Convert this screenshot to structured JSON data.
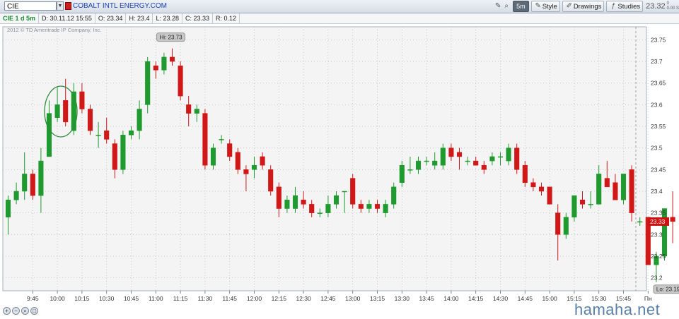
{
  "toolbar": {
    "symbol": "CIE",
    "company": "COBALT INTL ENERGY.COM",
    "period": "5m",
    "style_label": "Style",
    "drawings_label": "Drawings",
    "studies_label": "Studies",
    "last_price": "23.32",
    "change_top": "0",
    "change_bottom": "0.00 S"
  },
  "info": {
    "title": "CIE 1 d 5m",
    "date": "D: 30.11.12 15:55",
    "open": "O: 23.34",
    "high": "H: 23.4",
    "low": "L: 23.28",
    "close": "C: 23.33",
    "range": "R: 0.12"
  },
  "copyright": "2012 © TD Ameritrade IP Company, Inc.",
  "watermark": "hamaha.net",
  "colors": {
    "up": "#1e9a2e",
    "down": "#d01818",
    "grid": "#b8bec6",
    "plot_bg": "#f4f4f4",
    "price_tag": "#cc1111"
  },
  "chart_data": {
    "type": "candlestick",
    "ylim": [
      23.17,
      23.78
    ],
    "y_ticks": [
      "23.2",
      "23.25",
      "23.3",
      "23.35",
      "23.4",
      "23.45",
      "23.5",
      "23.55",
      "23.6",
      "23.65",
      "23.7",
      "23.75"
    ],
    "x_ticks": [
      "9:45",
      "10:00",
      "10:15",
      "10:30",
      "10:45",
      "11:00",
      "11:15",
      "11:30",
      "11:45",
      "12:00",
      "12:15",
      "12:30",
      "12:45",
      "13:00",
      "13:15",
      "13:30",
      "13:45",
      "14:00",
      "14:15",
      "14:30",
      "14:45",
      "15:00",
      "15:15",
      "15:30",
      "15:45",
      "Пн"
    ],
    "high_label": "Hi: 23.73",
    "low_label": "Lo: 23.19",
    "last_label": "23.33",
    "annotation": "circle around candles near 10:00",
    "candles": [
      {
        "o": 23.34,
        "h": 23.39,
        "l": 23.3,
        "c": 23.38
      },
      {
        "o": 23.38,
        "h": 23.42,
        "l": 23.37,
        "c": 23.4
      },
      {
        "o": 23.4,
        "h": 23.49,
        "l": 23.38,
        "c": 23.44
      },
      {
        "o": 23.44,
        "h": 23.45,
        "l": 23.38,
        "c": 23.39
      },
      {
        "o": 23.39,
        "h": 23.5,
        "l": 23.35,
        "c": 23.47
      },
      {
        "o": 23.48,
        "h": 23.61,
        "l": 23.48,
        "c": 23.58
      },
      {
        "o": 23.57,
        "h": 23.64,
        "l": 23.56,
        "c": 23.6
      },
      {
        "o": 23.61,
        "h": 23.66,
        "l": 23.55,
        "c": 23.56
      },
      {
        "o": 23.54,
        "h": 23.65,
        "l": 23.53,
        "c": 23.63
      },
      {
        "o": 23.63,
        "h": 23.65,
        "l": 23.58,
        "c": 23.59
      },
      {
        "o": 23.59,
        "h": 23.6,
        "l": 23.53,
        "c": 23.54
      },
      {
        "o": 23.53,
        "h": 23.56,
        "l": 23.5,
        "c": 23.53
      },
      {
        "o": 23.54,
        "h": 23.57,
        "l": 23.51,
        "c": 23.52
      },
      {
        "o": 23.51,
        "h": 23.52,
        "l": 23.43,
        "c": 23.45
      },
      {
        "o": 23.45,
        "h": 23.54,
        "l": 23.44,
        "c": 23.53
      },
      {
        "o": 23.53,
        "h": 23.55,
        "l": 23.52,
        "c": 23.54
      },
      {
        "o": 23.54,
        "h": 23.61,
        "l": 23.52,
        "c": 23.59
      },
      {
        "o": 23.6,
        "h": 23.71,
        "l": 23.58,
        "c": 23.7
      },
      {
        "o": 23.69,
        "h": 23.7,
        "l": 23.66,
        "c": 23.68
      },
      {
        "o": 23.68,
        "h": 23.72,
        "l": 23.67,
        "c": 23.71
      },
      {
        "o": 23.71,
        "h": 23.73,
        "l": 23.69,
        "c": 23.7
      },
      {
        "o": 23.69,
        "h": 23.7,
        "l": 23.61,
        "c": 23.62
      },
      {
        "o": 23.6,
        "h": 23.62,
        "l": 23.55,
        "c": 23.58
      },
      {
        "o": 23.58,
        "h": 23.6,
        "l": 23.56,
        "c": 23.59
      },
      {
        "o": 23.58,
        "h": 23.59,
        "l": 23.45,
        "c": 23.46
      },
      {
        "o": 23.46,
        "h": 23.51,
        "l": 23.45,
        "c": 23.5
      },
      {
        "o": 23.52,
        "h": 23.53,
        "l": 23.51,
        "c": 23.52
      },
      {
        "o": 23.51,
        "h": 23.52,
        "l": 23.47,
        "c": 23.48
      },
      {
        "o": 23.49,
        "h": 23.5,
        "l": 23.44,
        "c": 23.45
      },
      {
        "o": 23.45,
        "h": 23.46,
        "l": 23.4,
        "c": 23.44
      },
      {
        "o": 23.45,
        "h": 23.48,
        "l": 23.43,
        "c": 23.46
      },
      {
        "o": 23.48,
        "h": 23.49,
        "l": 23.45,
        "c": 23.46
      },
      {
        "o": 23.45,
        "h": 23.46,
        "l": 23.39,
        "c": 23.4
      },
      {
        "o": 23.41,
        "h": 23.42,
        "l": 23.34,
        "c": 23.36
      },
      {
        "o": 23.36,
        "h": 23.39,
        "l": 23.35,
        "c": 23.38
      },
      {
        "o": 23.36,
        "h": 23.41,
        "l": 23.35,
        "c": 23.39
      },
      {
        "o": 23.38,
        "h": 23.4,
        "l": 23.36,
        "c": 23.37
      },
      {
        "o": 23.37,
        "h": 23.38,
        "l": 23.34,
        "c": 23.35
      },
      {
        "o": 23.35,
        "h": 23.36,
        "l": 23.34,
        "c": 23.35
      },
      {
        "o": 23.35,
        "h": 23.39,
        "l": 23.34,
        "c": 23.37
      },
      {
        "o": 23.37,
        "h": 23.4,
        "l": 23.36,
        "c": 23.39
      },
      {
        "o": 23.4,
        "h": 23.4,
        "l": 23.35,
        "c": 23.4
      },
      {
        "o": 23.43,
        "h": 23.44,
        "l": 23.36,
        "c": 23.37
      },
      {
        "o": 23.37,
        "h": 23.38,
        "l": 23.35,
        "c": 23.36
      },
      {
        "o": 23.36,
        "h": 23.38,
        "l": 23.35,
        "c": 23.37
      },
      {
        "o": 23.37,
        "h": 23.38,
        "l": 23.35,
        "c": 23.36
      },
      {
        "o": 23.35,
        "h": 23.38,
        "l": 23.34,
        "c": 23.37
      },
      {
        "o": 23.37,
        "h": 23.42,
        "l": 23.36,
        "c": 23.41
      },
      {
        "o": 23.42,
        "h": 23.47,
        "l": 23.41,
        "c": 23.46
      },
      {
        "o": 23.45,
        "h": 23.48,
        "l": 23.44,
        "c": 23.45
      },
      {
        "o": 23.45,
        "h": 23.48,
        "l": 23.44,
        "c": 23.47
      },
      {
        "o": 23.47,
        "h": 23.48,
        "l": 23.46,
        "c": 23.47
      },
      {
        "o": 23.46,
        "h": 23.49,
        "l": 23.45,
        "c": 23.47
      },
      {
        "o": 23.46,
        "h": 23.51,
        "l": 23.45,
        "c": 23.5
      },
      {
        "o": 23.5,
        "h": 23.51,
        "l": 23.47,
        "c": 23.48
      },
      {
        "o": 23.49,
        "h": 23.5,
        "l": 23.45,
        "c": 23.48
      },
      {
        "o": 23.47,
        "h": 23.48,
        "l": 23.46,
        "c": 23.47
      },
      {
        "o": 23.47,
        "h": 23.48,
        "l": 23.46,
        "c": 23.46
      },
      {
        "o": 23.46,
        "h": 23.47,
        "l": 23.44,
        "c": 23.45
      },
      {
        "o": 23.47,
        "h": 23.49,
        "l": 23.46,
        "c": 23.48
      },
      {
        "o": 23.48,
        "h": 23.49,
        "l": 23.46,
        "c": 23.48
      },
      {
        "o": 23.47,
        "h": 23.51,
        "l": 23.46,
        "c": 23.5
      },
      {
        "o": 23.5,
        "h": 23.51,
        "l": 23.44,
        "c": 23.45
      },
      {
        "o": 23.46,
        "h": 23.47,
        "l": 23.41,
        "c": 23.42
      },
      {
        "o": 23.42,
        "h": 23.43,
        "l": 23.4,
        "c": 23.41
      },
      {
        "o": 23.41,
        "h": 23.42,
        "l": 23.39,
        "c": 23.4
      },
      {
        "o": 23.41,
        "h": 23.41,
        "l": 23.37,
        "c": 23.37
      },
      {
        "o": 23.35,
        "h": 23.37,
        "l": 23.24,
        "c": 23.3
      },
      {
        "o": 23.3,
        "h": 23.35,
        "l": 23.29,
        "c": 23.34
      },
      {
        "o": 23.34,
        "h": 23.39,
        "l": 23.33,
        "c": 23.39
      },
      {
        "o": 23.38,
        "h": 23.4,
        "l": 23.36,
        "c": 23.37
      },
      {
        "o": 23.37,
        "h": 23.4,
        "l": 23.36,
        "c": 23.37
      },
      {
        "o": 23.37,
        "h": 23.46,
        "l": 23.37,
        "c": 23.44
      },
      {
        "o": 23.43,
        "h": 23.47,
        "l": 23.41,
        "c": 23.41
      },
      {
        "o": 23.42,
        "h": 23.44,
        "l": 23.38,
        "c": 23.38
      },
      {
        "o": 23.38,
        "h": 23.4,
        "l": 23.37,
        "c": 23.44
      },
      {
        "o": 23.45,
        "h": 23.46,
        "l": 23.33,
        "c": 23.35
      },
      {
        "o": 23.33,
        "h": 23.34,
        "l": 23.32,
        "c": 23.33
      },
      {
        "o": 23.34,
        "h": 23.34,
        "l": 23.23,
        "c": 23.23
      },
      {
        "o": 23.23,
        "h": 23.26,
        "l": 23.19,
        "c": 23.25
      },
      {
        "o": 23.25,
        "h": 23.36,
        "l": 23.24,
        "c": 23.36
      },
      {
        "o": 23.34,
        "h": 23.4,
        "l": 23.28,
        "c": 23.33
      }
    ]
  }
}
